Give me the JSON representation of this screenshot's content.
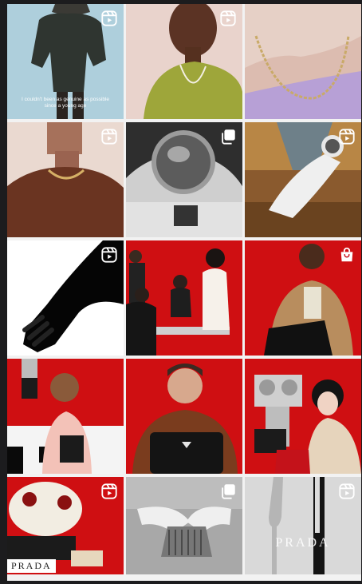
{
  "grid": {
    "tiles": [
      {
        "id": "t1",
        "badge": "reels-icon",
        "caption": "I couldn't been as genuine as possible since a young age"
      },
      {
        "id": "t2",
        "badge": "reels-icon"
      },
      {
        "id": "t3",
        "badge": "none"
      },
      {
        "id": "t4",
        "badge": "reels-icon"
      },
      {
        "id": "t5",
        "badge": "carousel-icon"
      },
      {
        "id": "t6",
        "badge": "reels-icon"
      },
      {
        "id": "t7",
        "badge": "reels-icon"
      },
      {
        "id": "t8",
        "badge": "none"
      },
      {
        "id": "t9",
        "badge": "shopping-bag-icon"
      },
      {
        "id": "t10",
        "badge": "none"
      },
      {
        "id": "t11",
        "badge": "none"
      },
      {
        "id": "t12",
        "badge": "none"
      },
      {
        "id": "t13",
        "badge": "reels-icon",
        "sign": "PRADA"
      },
      {
        "id": "t14",
        "badge": "carousel-icon"
      },
      {
        "id": "t15",
        "badge": "reels-icon",
        "watermark": "PRADA"
      }
    ]
  }
}
